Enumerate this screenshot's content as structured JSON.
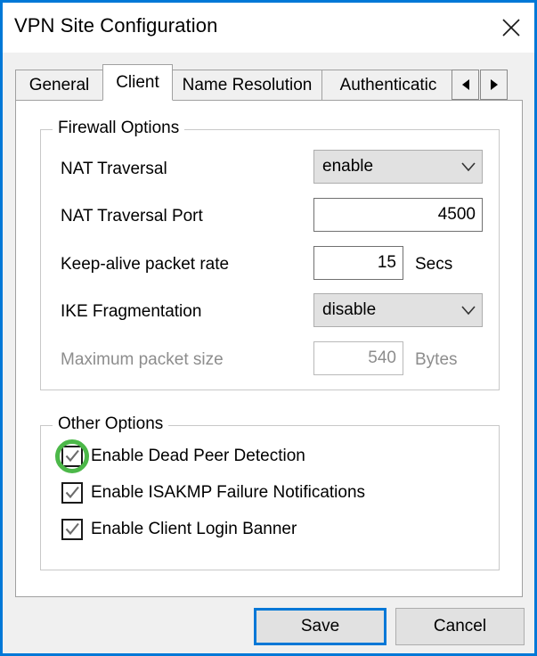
{
  "window": {
    "title": "VPN Site Configuration",
    "close_icon": "close-icon",
    "accent_color": "#0078d7",
    "highlight_color": "#4cb849"
  },
  "tabs": {
    "items": [
      {
        "label": "General",
        "active": false
      },
      {
        "label": "Client",
        "active": true
      },
      {
        "label": "Name Resolution",
        "active": false
      },
      {
        "label": "Authenticatic",
        "active": false
      }
    ],
    "scroll_left_icon": "triangle-left-icon",
    "scroll_right_icon": "triangle-right-icon"
  },
  "firewall_group": {
    "legend": "Firewall Options",
    "nat_traversal": {
      "label": "NAT Traversal",
      "value": "enable",
      "arrow_icon": "chevron-down-icon"
    },
    "nat_traversal_port": {
      "label": "NAT Traversal Port",
      "value": "4500"
    },
    "keep_alive": {
      "label": "Keep-alive packet rate",
      "value": "15",
      "unit": "Secs"
    },
    "ike_fragmentation": {
      "label": "IKE Fragmentation",
      "value": "disable",
      "arrow_icon": "chevron-down-icon"
    },
    "max_packet_size": {
      "label": "Maximum packet size",
      "value": "540",
      "unit": "Bytes",
      "disabled": true
    }
  },
  "other_group": {
    "legend": "Other Options",
    "checkboxes": [
      {
        "label": "Enable Dead Peer Detection",
        "checked": true,
        "highlighted": true
      },
      {
        "label": "Enable ISAKMP Failure Notifications",
        "checked": true,
        "highlighted": false
      },
      {
        "label": "Enable Client Login Banner",
        "checked": true,
        "highlighted": false
      }
    ]
  },
  "buttons": {
    "save": "Save",
    "cancel": "Cancel"
  }
}
